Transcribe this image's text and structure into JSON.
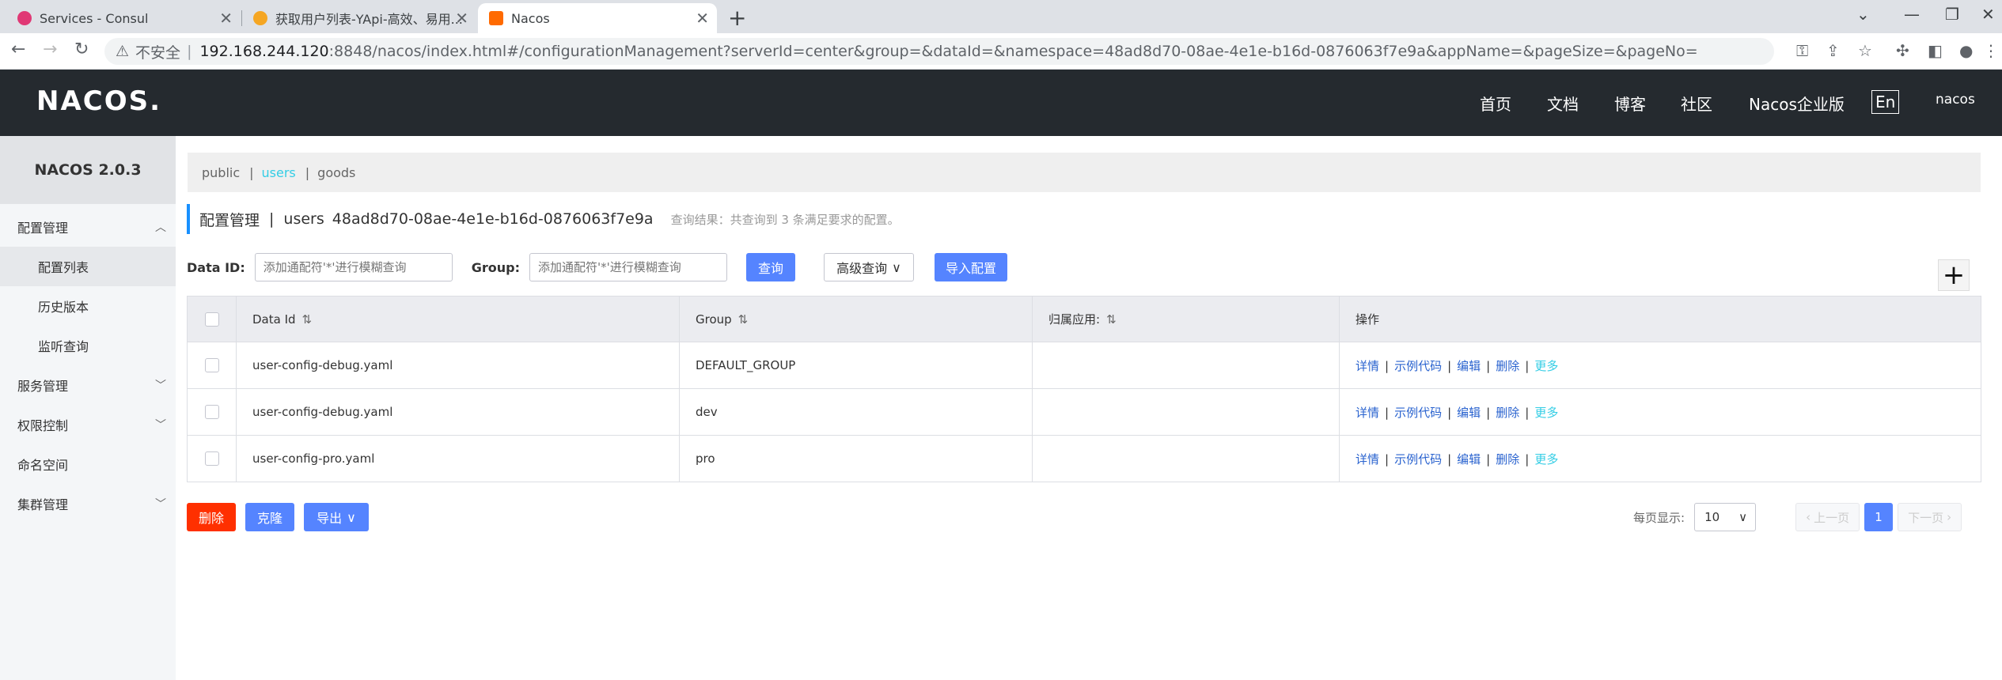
{
  "browser": {
    "tabs": [
      {
        "title": "Services - Consul"
      },
      {
        "title": "获取用户列表-YApi-高效、易用..."
      },
      {
        "title": "Nacos"
      }
    ],
    "address": {
      "insecure_label": "不安全",
      "host": "192.168.244.120",
      "path": ":8848/nacos/index.html#/configurationManagement?serverId=center&group=&dataId=&namespace=48ad8d70-08ae-4e1e-b16d-0876063f7e9a&appName=&pageSize=&pageNo="
    }
  },
  "header": {
    "logo": "NACOS.",
    "nav": [
      "首页",
      "文档",
      "博客",
      "社区",
      "Nacos企业版"
    ],
    "lang": "En",
    "user": "nacos"
  },
  "sidebar": {
    "title": "NACOS 2.0.3",
    "items": [
      {
        "label": "配置管理"
      },
      {
        "label": "配置列表"
      },
      {
        "label": "历史版本"
      },
      {
        "label": "监听查询"
      },
      {
        "label": "服务管理"
      },
      {
        "label": "权限控制"
      },
      {
        "label": "命名空间"
      },
      {
        "label": "集群管理"
      }
    ]
  },
  "namespaces": [
    "public",
    "users",
    "goods"
  ],
  "page_title": {
    "label": "配置管理",
    "separator": "|",
    "namespace_name": "users",
    "namespace_id": "48ad8d70-08ae-4e1e-b16d-0876063f7e9a",
    "result_hint": "查询结果：共查询到 3 条满足要求的配置。"
  },
  "search": {
    "data_id_label": "Data ID:",
    "data_id_placeholder": "添加通配符'*'进行模糊查询",
    "group_label": "Group:",
    "group_placeholder": "添加通配符'*'进行模糊查询",
    "query_button": "查询",
    "advanced_button": "高级查询",
    "import_button": "导入配置"
  },
  "table": {
    "headers": [
      "Data Id",
      "Group",
      "归属应用:",
      "操作"
    ],
    "rows": [
      {
        "data_id": "user-config-debug.yaml",
        "group": "DEFAULT_GROUP",
        "app": ""
      },
      {
        "data_id": "user-config-debug.yaml",
        "group": "dev",
        "app": ""
      },
      {
        "data_id": "user-config-pro.yaml",
        "group": "pro",
        "app": ""
      }
    ],
    "ops": [
      "详情",
      "示例代码",
      "编辑",
      "删除",
      "更多"
    ]
  },
  "bottom": {
    "delete_button": "删除",
    "clone_button": "克隆",
    "export_button": "导出"
  },
  "pagination": {
    "page_size_label": "每页显示:",
    "page_size": "10",
    "prev": "上一页",
    "current": "1",
    "next": "下一页"
  },
  "colors": {
    "header_bg": "#252a2f",
    "primary": "#5584ff",
    "danger": "#ff3000",
    "link": "#2a63cf",
    "accent": "#33cde5"
  }
}
